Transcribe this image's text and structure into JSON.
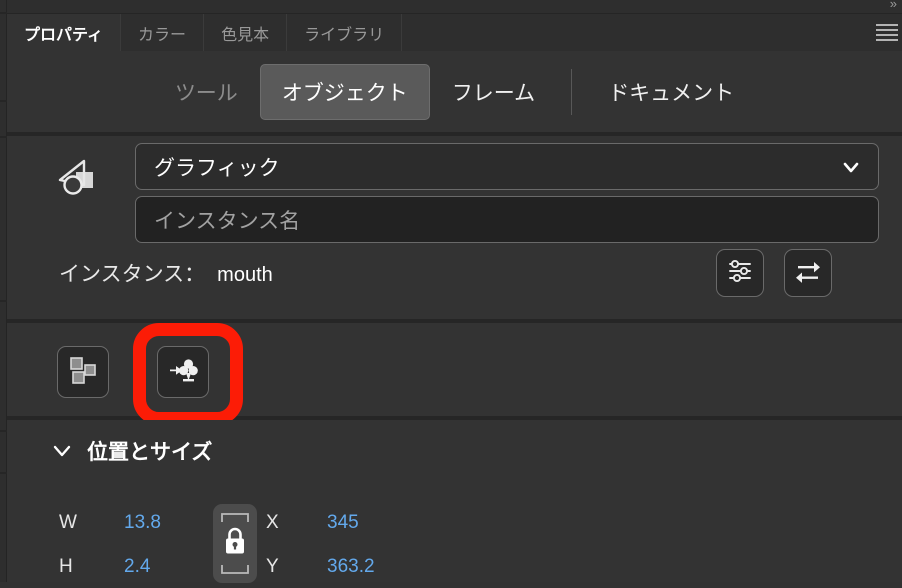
{
  "window": {
    "expand_icon": "chevron-double-right-icon",
    "menu_icon": "hamburger-menu-icon"
  },
  "tabs": [
    {
      "label": "プロパティ",
      "active": true
    },
    {
      "label": "カラー",
      "active": false
    },
    {
      "label": "色見本",
      "active": false
    },
    {
      "label": "ライブラリ",
      "active": false
    }
  ],
  "subtabs": [
    {
      "label": "ツール",
      "state": "dim"
    },
    {
      "label": "オブジェクト",
      "state": "selected"
    },
    {
      "label": "フレーム",
      "state": "normal"
    },
    {
      "label": "ドキュメント",
      "state": "normal"
    }
  ],
  "symbol": {
    "type_icon": "symbol-graphic-icon",
    "type_value": "グラフィック",
    "type_caret_icon": "chevron-down-icon",
    "instance_name_placeholder": "インスタンス名",
    "instance_name_value": "",
    "instance_label": "インスタンス：",
    "instance_value": "mouth",
    "sliders_button_icon": "sliders-icon",
    "swap_button_icon": "swap-arrows-icon"
  },
  "actions": {
    "grid_button_icon": "break-apart-grid-icon",
    "clover_button_icon": "swap-symbol-clover-icon",
    "highlight_color": "#FC1C06"
  },
  "position_size": {
    "twisty_icon": "chevron-down-icon",
    "title": "位置とサイズ",
    "lock_icon": "lock-closed-icon",
    "fields": [
      {
        "key": "W",
        "value": "13.8"
      },
      {
        "key": "H",
        "value": "2.4"
      },
      {
        "key": "X",
        "value": "345"
      },
      {
        "key": "Y",
        "value": "363.2"
      }
    ],
    "value_color": "#63A9EC"
  }
}
